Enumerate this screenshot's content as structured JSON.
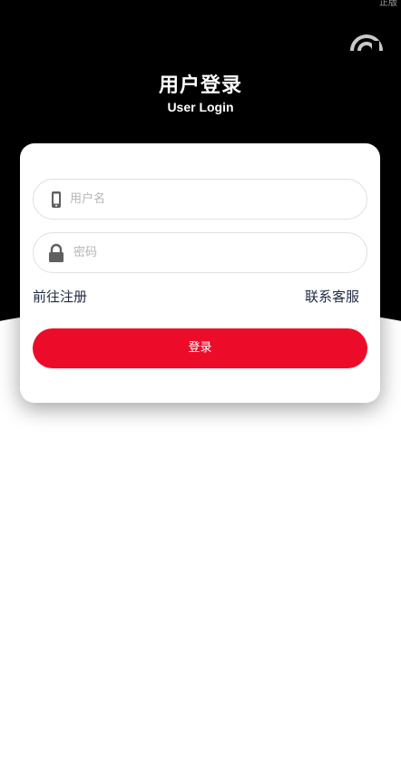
{
  "header": {
    "version_label": "正版",
    "title": "用户登录",
    "subtitle": "User Login",
    "refresh_icon": "refresh-icon"
  },
  "form": {
    "username": {
      "placeholder": "用户名",
      "value": "",
      "icon": "phone-icon"
    },
    "password": {
      "placeholder": "密码",
      "value": "",
      "icon": "lock-icon"
    },
    "register_link": "前往注册",
    "service_link": "联系客服",
    "login_button": "登录"
  },
  "colors": {
    "hero_background": "#000000",
    "accent": "#ec0c2a",
    "link_text": "#1f2a44"
  }
}
